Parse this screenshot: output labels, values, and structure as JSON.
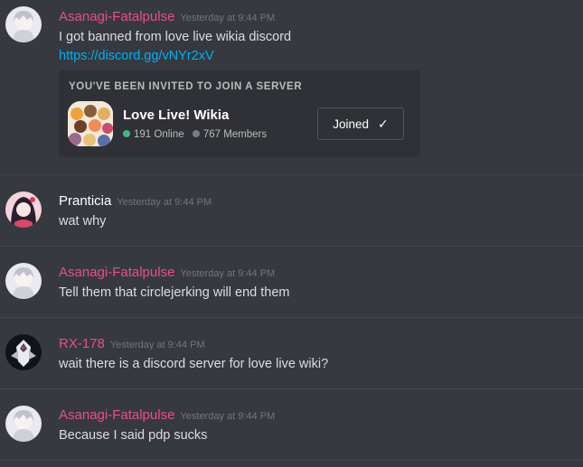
{
  "messages": [
    {
      "username": "Asanagi-Fatalpulse",
      "color": "#e84f8c",
      "timestamp": "Yesterday at 9:44 PM",
      "lines": [
        "I got banned from love live wikia discord",
        "https://discord.gg/vNYr2xV"
      ]
    },
    {
      "username": "Pranticia",
      "color": "#ffffff",
      "timestamp": "Yesterday at 9:44 PM",
      "lines": [
        "wat why"
      ]
    },
    {
      "username": "Asanagi-Fatalpulse",
      "color": "#e84f8c",
      "timestamp": "Yesterday at 9:44 PM",
      "lines": [
        "Tell them that circlejerking will end them"
      ]
    },
    {
      "username": "RX-178",
      "color": "#e84f8c",
      "timestamp": "Yesterday at 9:44 PM",
      "lines": [
        "wait there is a discord server for love live wiki?"
      ]
    },
    {
      "username": "Asanagi-Fatalpulse",
      "color": "#e84f8c",
      "timestamp": "Yesterday at 9:44 PM",
      "lines": [
        "Because I said pdp sucks"
      ]
    }
  ],
  "invite": {
    "header": "YOU'VE BEEN INVITED TO JOIN A SERVER",
    "server_name": "Love Live! Wikia",
    "online": "191 Online",
    "members": "767 Members",
    "button_label": "Joined",
    "online_color": "#43b581",
    "members_color": "#747f8d"
  }
}
